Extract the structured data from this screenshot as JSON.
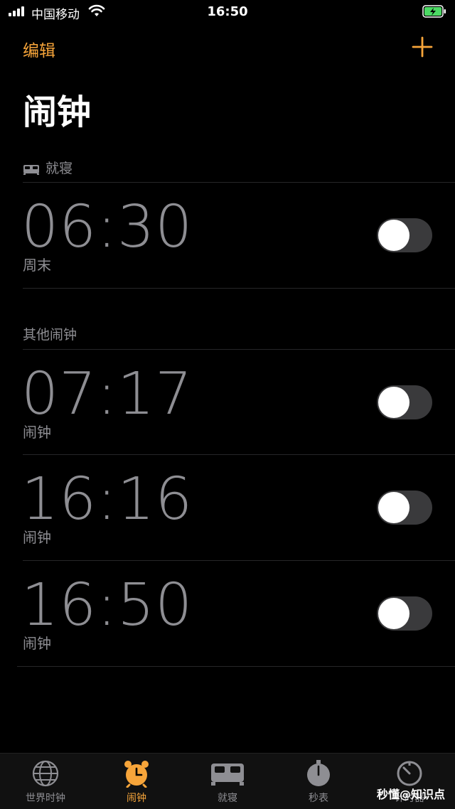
{
  "status_bar": {
    "carrier": "中国移动",
    "time": "16:50"
  },
  "nav": {
    "edit_label": "编辑",
    "title": "闹钟"
  },
  "sections": {
    "bedtime_header": "就寝",
    "other_header": "其他闹钟"
  },
  "alarms": [
    {
      "time": "06:30",
      "label": "周末",
      "enabled": false
    },
    {
      "time": "07:17",
      "label": "闹钟",
      "enabled": false
    },
    {
      "time": "16:16",
      "label": "闹钟",
      "enabled": false
    },
    {
      "time": "16:50",
      "label": "闹钟",
      "enabled": false
    }
  ],
  "tabs": [
    {
      "label": "世界时钟",
      "icon": "globe-icon",
      "active": false
    },
    {
      "label": "闹钟",
      "icon": "alarm-clock-icon",
      "active": true
    },
    {
      "label": "就寝",
      "icon": "bed-icon",
      "active": false
    },
    {
      "label": "秒表",
      "icon": "stopwatch-icon",
      "active": false
    },
    {
      "label": "计时器",
      "icon": "timer-icon",
      "active": false
    }
  ],
  "watermark": "秒懂@知识点",
  "colors": {
    "accent": "#f7a53a",
    "background": "#000000",
    "secondary_text": "#8e8e93",
    "toggle_off": "#3a3a3c"
  }
}
